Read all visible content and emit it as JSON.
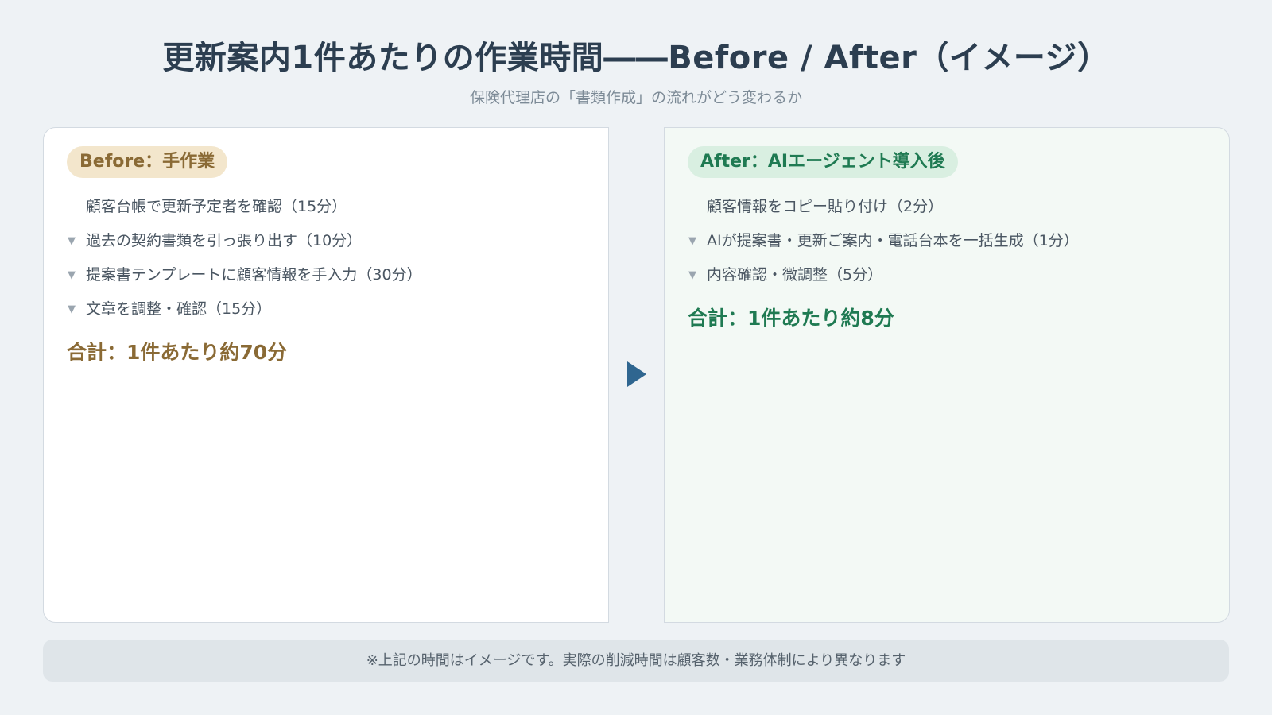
{
  "title": "更新案内1件あたりの作業時間――Before / After（イメージ）",
  "subtitle": "保険代理店の「書類作成」の流れがどう変わるか",
  "before": {
    "label": "Before：手作業",
    "steps": [
      "顧客台帳で更新予定者を確認（15分）",
      "過去の契約書類を引っ張り出す（10分）",
      "提案書テンプレートに顧客情報を手入力（30分）",
      "文章を調整・確認（15分）"
    ],
    "total": "合計：1件あたり約70分"
  },
  "after": {
    "label": "After：AIエージェント導入後",
    "steps": [
      "顧客情報をコピー貼り付け（2分）",
      "AIが提案書・更新ご案内・電話台本を一括生成（1分）",
      "内容確認・微調整（5分）"
    ],
    "total": "合計：1件あたり約8分"
  },
  "step_arrow_glyph": "▼",
  "footnote": "※上記の時間はイメージです。実際の削減時間は顧客数・業務体制により異なります",
  "colors": {
    "before_accent": "#8a6a35",
    "before_pill_bg": "#f3e6cc",
    "after_accent": "#1f7a52",
    "after_pill_bg": "#d9efe1",
    "transition_arrow": "#2f6690"
  }
}
